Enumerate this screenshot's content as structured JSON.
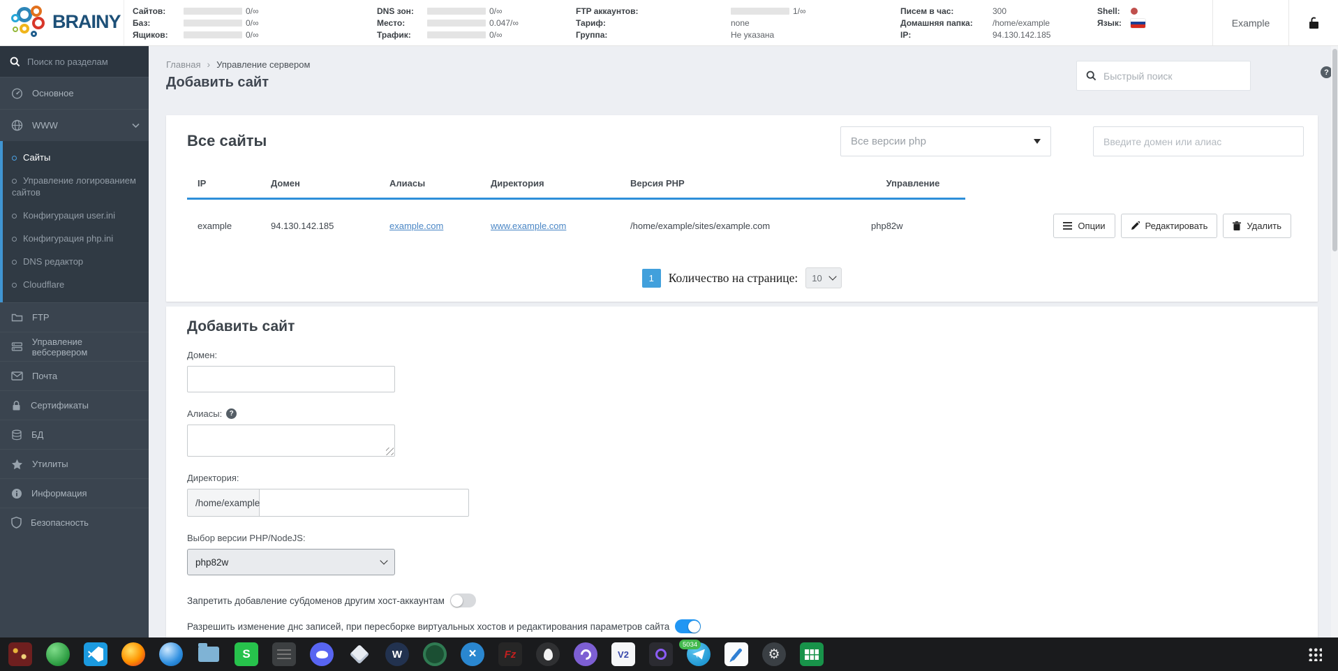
{
  "colors": {
    "accent": "#2e8fd9",
    "link": "#4a86c5",
    "toggle_on": "#2196f3",
    "sidebar_bg": "#3a444f",
    "taskbar_bg": "#1a1b1d",
    "shell_dot": "#c0504d",
    "flag": [
      "#ffffff",
      "#1c3f94",
      "#d52b1e"
    ]
  },
  "header": {
    "logo": "BRAINY",
    "account": "Example",
    "stats": {
      "sites": {
        "label": "Сайтов:",
        "value": "0/∞"
      },
      "bases": {
        "label": "Баз:",
        "value": "0/∞"
      },
      "boxes": {
        "label": "Ящиков:",
        "value": "0/∞"
      },
      "dns": {
        "label": "DNS зон:",
        "value": "0/∞"
      },
      "space": {
        "label": "Место:",
        "value": "0.047/∞"
      },
      "traffic": {
        "label": "Трафик:",
        "value": "0/∞"
      },
      "ftp": {
        "label": "FTP аккаунтов:",
        "value": "1/∞"
      },
      "tariff": {
        "label": "Тариф:",
        "value": "none"
      },
      "group": {
        "label": "Группа:",
        "value": "Не указана"
      },
      "mail_rate": {
        "label": "Писем в час:",
        "value": "300"
      },
      "home": {
        "label": "Домашняя папка:",
        "value": "/home/example"
      },
      "ip": {
        "label": "IP:",
        "value": "94.130.142.185"
      },
      "shell": {
        "label": "Shell:"
      },
      "lang": {
        "label": "Язык:"
      }
    }
  },
  "sidebar": {
    "search_placeholder": "Поиск по разделам",
    "items": [
      {
        "label": "Основное"
      },
      {
        "label": "WWW"
      },
      {
        "label": "FTP"
      },
      {
        "label": "Управление вебсервером"
      },
      {
        "label": "Почта"
      },
      {
        "label": "Сертификаты"
      },
      {
        "label": "БД"
      },
      {
        "label": "Утилиты"
      },
      {
        "label": "Информация"
      },
      {
        "label": "Безопасность"
      }
    ],
    "www_children": [
      {
        "label": "Сайты",
        "active": true
      },
      {
        "label": "Управление логированием сайтов"
      },
      {
        "label": "Конфигурация user.ini"
      },
      {
        "label": "Конфигурация php.ini"
      },
      {
        "label": "DNS редактор"
      },
      {
        "label": "Cloudflare"
      }
    ]
  },
  "page": {
    "breadcrumb_home": "Главная",
    "breadcrumb_current": "Управление сервером",
    "title": "Добавить сайт",
    "quick_search_placeholder": "Быстрый поиск"
  },
  "sites": {
    "title": "Все сайты",
    "php_filter_placeholder": "Все версии php",
    "domain_filter_placeholder": "Введите домен или алиас",
    "headers": [
      "IP",
      "Домен",
      "Алиасы",
      "Директория",
      "Версия PHP",
      "Управление"
    ],
    "row": {
      "name": "example",
      "ip": "94.130.142.185",
      "alias": "example.com",
      "www_alias": "www.example.com",
      "directory": "/home/example/sites/example.com",
      "php": "php82w"
    },
    "actions": {
      "options": "Опции",
      "edit": "Редактировать",
      "delete": "Удалить"
    },
    "pagination": {
      "page": "1",
      "label": "Количество на странице:",
      "per_page": "10"
    }
  },
  "form": {
    "title": "Добавить сайт",
    "domain_label": "Домен:",
    "aliases_label": "Алиасы:",
    "directory_label": "Директория:",
    "directory_prefix": "/home/example/",
    "php_label": "Выбор версии PHP/NodeJS:",
    "php_value": "php82w",
    "toggle_subdomains_label": "Запретить добавление субдоменов другим хост-аккаунтам",
    "toggle_dns_label": "Разрешить изменение днс записей, при пересборке виртуальных хостов и редактирования параметров сайта"
  },
  "taskbar": {
    "badge": "5034",
    "glyphs": {
      "wiki": "W",
      "filezilla": "Fz",
      "v2rayn": "V2",
      "green_s": "S"
    },
    "apps": [
      "wine",
      "green-orb",
      "vscode",
      "firefox",
      "blue-sphere",
      "files",
      "green-s-app",
      "notes",
      "discord",
      "diamond-app",
      "wiki-app",
      "dark-green-app",
      "blue-x-app",
      "filezilla",
      "egg-app",
      "viber",
      "v2rayn",
      "purple-ring-app",
      "telegram",
      "text-editor",
      "settings-app",
      "calc"
    ]
  }
}
